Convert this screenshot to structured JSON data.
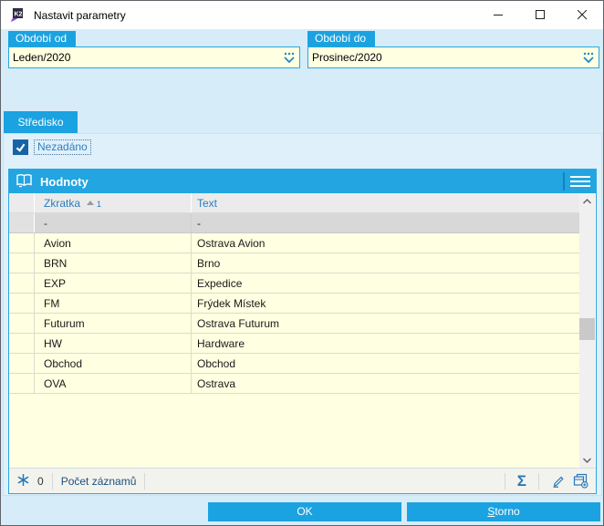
{
  "window": {
    "title": "Nastavit parametry"
  },
  "filters": {
    "period_from": {
      "label": "Období od",
      "value": "Leden/2020"
    },
    "period_to": {
      "label": "Období do",
      "value": "Prosinec/2020"
    }
  },
  "tabs": [
    {
      "label": "Středisko"
    }
  ],
  "checkbox": {
    "label": "Nezadáno",
    "checked": true
  },
  "grid": {
    "title": "Hodnoty",
    "columns": [
      {
        "label": "Zkratka",
        "sort_dir": "asc",
        "sort_order": "1"
      },
      {
        "label": "Text"
      }
    ],
    "rows": [
      {
        "zkratka": "-",
        "text": "-",
        "selected": true
      },
      {
        "zkratka": "Avion",
        "text": "Ostrava Avion"
      },
      {
        "zkratka": "BRN",
        "text": "Brno"
      },
      {
        "zkratka": "EXP",
        "text": "Expedice"
      },
      {
        "zkratka": "FM",
        "text": "Frýdek Místek"
      },
      {
        "zkratka": "Futurum",
        "text": "Ostrava Futurum"
      },
      {
        "zkratka": "HW",
        "text": "Hardware"
      },
      {
        "zkratka": "Obchod",
        "text": "Obchod"
      },
      {
        "zkratka": "OVA",
        "text": "Ostrava"
      }
    ],
    "status": {
      "count": "0",
      "label": "Počet záznamů"
    }
  },
  "actions": {
    "ok": "OK",
    "cancel_accesskey": "S",
    "cancel_rest": "torno"
  },
  "colors": {
    "accent": "#1ba2e0",
    "row_bg": "#ffffe1",
    "selected_row_bg": "#d8d8d8",
    "checkbox_bg": "#1663a6",
    "column_header_text": "#2b7cbf",
    "dialog_bg": "#d6ecf9"
  }
}
